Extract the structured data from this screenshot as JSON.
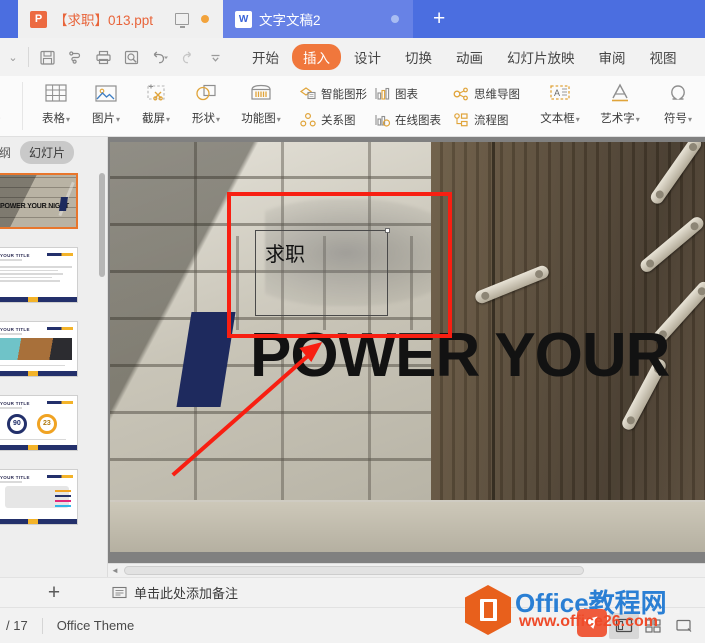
{
  "titlebar": {
    "tabs": [
      {
        "icon": "powerpoint-icon",
        "icon_letter": "P",
        "label": "【求职】013.ppt",
        "active": true
      },
      {
        "icon": "word-icon",
        "icon_letter": "W",
        "label": "文字文稿2",
        "active": false
      }
    ],
    "new_tab_label": "+",
    "presenter_icon": "monitor-icon",
    "status_dot_color": "#f2a33c"
  },
  "quick_access": {
    "collapse_label": "⌄",
    "buttons": [
      {
        "name": "save-button",
        "icon": "save-icon"
      },
      {
        "name": "save-cloud-button",
        "icon": "cloud-save-icon"
      },
      {
        "name": "print-button",
        "icon": "print-icon"
      },
      {
        "name": "print-preview-button",
        "icon": "print-preview-icon"
      },
      {
        "name": "undo-button",
        "icon": "undo-icon"
      },
      {
        "name": "redo-button",
        "icon": "redo-icon"
      },
      {
        "name": "customize-qat-button",
        "icon": "chevron-down-icon"
      }
    ]
  },
  "ribbon_tabs": [
    {
      "label": "开始",
      "active": false
    },
    {
      "label": "插入",
      "active": true
    },
    {
      "label": "设计",
      "active": false
    },
    {
      "label": "切换",
      "active": false
    },
    {
      "label": "动画",
      "active": false
    },
    {
      "label": "幻灯片放映",
      "active": false
    },
    {
      "label": "审阅",
      "active": false
    },
    {
      "label": "视图",
      "active": false
    }
  ],
  "ribbon": {
    "cut_off_label": "片",
    "big_buttons": [
      {
        "label": "表格",
        "icon": "table-icon",
        "caret": "▾"
      },
      {
        "label": "图片",
        "icon": "picture-icon",
        "caret": "▾"
      },
      {
        "label": "截屏",
        "icon": "screenshot-icon",
        "caret": "▾"
      },
      {
        "label": "形状",
        "icon": "shapes-icon",
        "caret": "▾"
      },
      {
        "label": "功能图",
        "icon": "function-chart-icon",
        "caret": "▾"
      }
    ],
    "stack_a": [
      {
        "label": "智能图形",
        "icon": "smartart-icon"
      },
      {
        "label": "关系图",
        "icon": "relation-chart-icon"
      }
    ],
    "stack_b": [
      {
        "label": "图表",
        "icon": "chart-icon"
      },
      {
        "label": "在线图表",
        "icon": "online-chart-icon"
      }
    ],
    "stack_c": [
      {
        "label": "思维导图",
        "icon": "mindmap-icon"
      },
      {
        "label": "流程图",
        "icon": "flowchart-icon"
      }
    ],
    "big_buttons_right": [
      {
        "label": "文本框",
        "icon": "textbox-icon",
        "caret": "▾"
      },
      {
        "label": "艺术字",
        "icon": "wordart-icon",
        "caret": "▾"
      },
      {
        "label": "符号",
        "icon": "symbol-icon",
        "caret": "▾"
      }
    ]
  },
  "left_panel": {
    "tabs": [
      {
        "label": "纲",
        "active": false
      },
      {
        "label": "幻灯片",
        "active": true
      }
    ],
    "thumbnails": [
      {
        "index": 1,
        "title": "POWER YOUR NIGHT",
        "selected": true,
        "kind": "cover"
      },
      {
        "index": 2,
        "title": "YOUR TITLE",
        "selected": false,
        "kind": "text-list"
      },
      {
        "index": 3,
        "title": "YOUR TITLE",
        "selected": false,
        "kind": "photo"
      },
      {
        "index": 4,
        "title": "YOUR TITLE",
        "selected": false,
        "kind": "rings"
      },
      {
        "index": 5,
        "title": "YOUR TITLE",
        "selected": false,
        "kind": "map"
      }
    ],
    "ring_values": [
      "90",
      "23"
    ]
  },
  "slide": {
    "title_text": "POWER YOUR",
    "textbox_value": "求职",
    "annotation_rect_color": "#f81f12",
    "annotation_arrow_color": "#f81f12"
  },
  "notes": {
    "add_slide_label": "+",
    "icon": "notes-icon",
    "placeholder": "单击此处添加备注"
  },
  "statusbar": {
    "page_label": "/ 17",
    "theme_label": "Office Theme",
    "buttons": [
      {
        "name": "list-view-button",
        "icon": "list-lines-icon",
        "selected": false
      },
      {
        "name": "normal-view-button",
        "icon": "normal-view-icon",
        "selected": true
      },
      {
        "name": "slide-sorter-button",
        "icon": "slide-sorter-icon",
        "selected": false
      },
      {
        "name": "reading-view-button",
        "icon": "reading-view-icon",
        "selected": false
      }
    ]
  },
  "watermark": {
    "brand": "Office教程网",
    "url": "www.office26.com",
    "hex_color": "#e8601c",
    "brand_color": "#2a7fd4",
    "url_color": "#ef4b2a"
  }
}
